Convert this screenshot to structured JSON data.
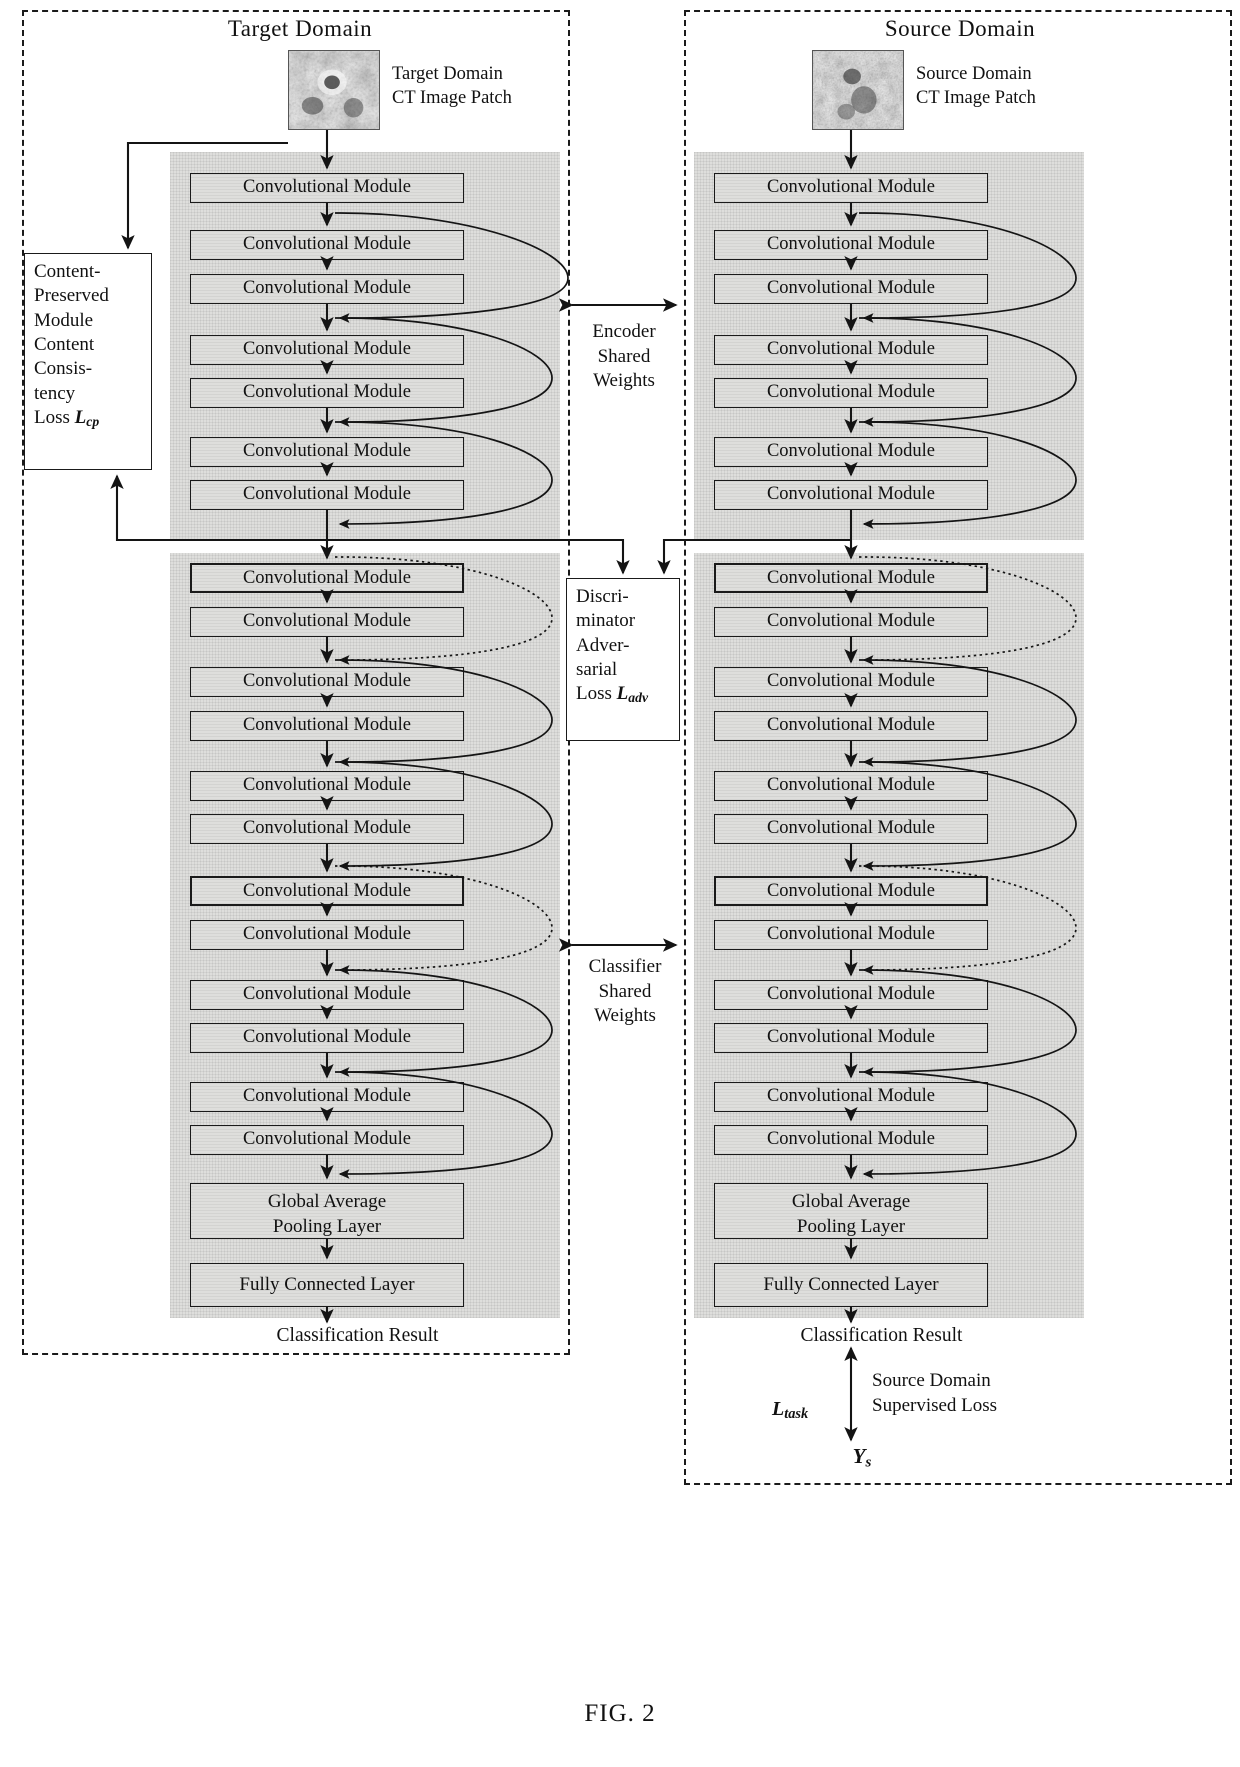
{
  "figure": {
    "caption": "FIG. 2"
  },
  "domains": {
    "target": {
      "title": "Target Domain",
      "patch_caption_line1": "Target Domain",
      "patch_caption_line2": "CT Image Patch",
      "classification_result": "Classification Result"
    },
    "source": {
      "title": "Source Domain",
      "patch_caption_line1": "Source Domain",
      "patch_caption_line2": "CT Image Patch",
      "classification_result": "Classification Result"
    }
  },
  "module_label": "Convolutional Module",
  "encoder": {
    "modules": [
      "Convolutional Module",
      "Convolutional Module",
      "Convolutional Module",
      "Convolutional Module",
      "Convolutional Module",
      "Convolutional Module",
      "Convolutional Module"
    ]
  },
  "classifier": {
    "modules": [
      "Convolutional Module",
      "Convolutional Module",
      "Convolutional Module",
      "Convolutional Module",
      "Convolutional Module",
      "Convolutional Module",
      "Convolutional Module",
      "Convolutional Module",
      "Convolutional Module",
      "Convolutional Module",
      "Convolutional Module",
      "Convolutional Module"
    ],
    "global_average_pooling_line1": "Global Average",
    "global_average_pooling_line2": "Pooling Layer",
    "fully_connected": "Fully Connected Layer"
  },
  "content_preserved_box": {
    "line1": "Content-",
    "line2": "Preserved",
    "line3": "Module",
    "line4": "Content",
    "line5": "Consis-",
    "line6": "tency",
    "line7_prefix": "Loss ",
    "loss_symbol": "L",
    "loss_subscript": "cp"
  },
  "discriminator_box": {
    "line1": "Discri-",
    "line2": "minator",
    "line3": "Adver-",
    "line4": "sarial",
    "line5_prefix": "Loss ",
    "loss_symbol": "L",
    "loss_subscript": "adv"
  },
  "shared_weights": {
    "encoder_line1": "Encoder",
    "encoder_line2": "Shared",
    "encoder_line3": "Weights",
    "classifier_line1": "Classifier",
    "classifier_line2": "Shared",
    "classifier_line3": "Weights"
  },
  "supervised_loss": {
    "task_symbol": "L",
    "task_subscript": "task",
    "line1": "Source Domain",
    "line2": "Supervised Loss",
    "label_symbol": "Y",
    "label_subscript": "s"
  },
  "colors": {
    "ink": "#111111",
    "panel_gray": "#dededc",
    "frame": "#1a1a1a",
    "page_background": "#ffffff"
  }
}
